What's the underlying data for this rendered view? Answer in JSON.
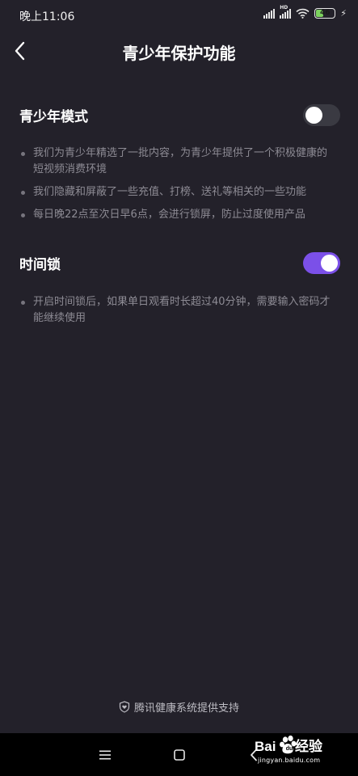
{
  "status_bar": {
    "time": "晚上11:06",
    "battery_level": "46",
    "icons": [
      "signal-icon",
      "signal-hd-icon",
      "wifi-icon",
      "battery-icon",
      "charging-bolt-icon"
    ]
  },
  "header": {
    "title": "青少年保护功能",
    "back_icon": "chevron-left-icon"
  },
  "sections": [
    {
      "title": "青少年模式",
      "enabled": false,
      "bullets": [
        "我们为青少年精选了一批内容，为青少年提供了一个积极健康的短视频消费环境",
        "我们隐藏和屏蔽了一些充值、打榜、送礼等相关的一些功能",
        "每日晚22点至次日早6点，会进行锁屏，防止过度使用产品"
      ]
    },
    {
      "title": "时间锁",
      "enabled": true,
      "bullets": [
        "开启时间锁后，如果单日观看时长超过40分钟，需要输入密码才能继续使用"
      ]
    }
  ],
  "footer": {
    "text": "腾讯健康系统提供支持",
    "icon": "shield-heart-icon"
  },
  "nav_bar": {
    "icons": [
      "menu-icon",
      "home-square-icon",
      "back-triangle-icon"
    ]
  },
  "watermark": {
    "sub": "jingyan.baidu.com"
  },
  "colors": {
    "background": "#23212a",
    "accent": "#7b50e8",
    "toggle_off": "#3a3a42",
    "bullet_text": "#8d8b94"
  }
}
